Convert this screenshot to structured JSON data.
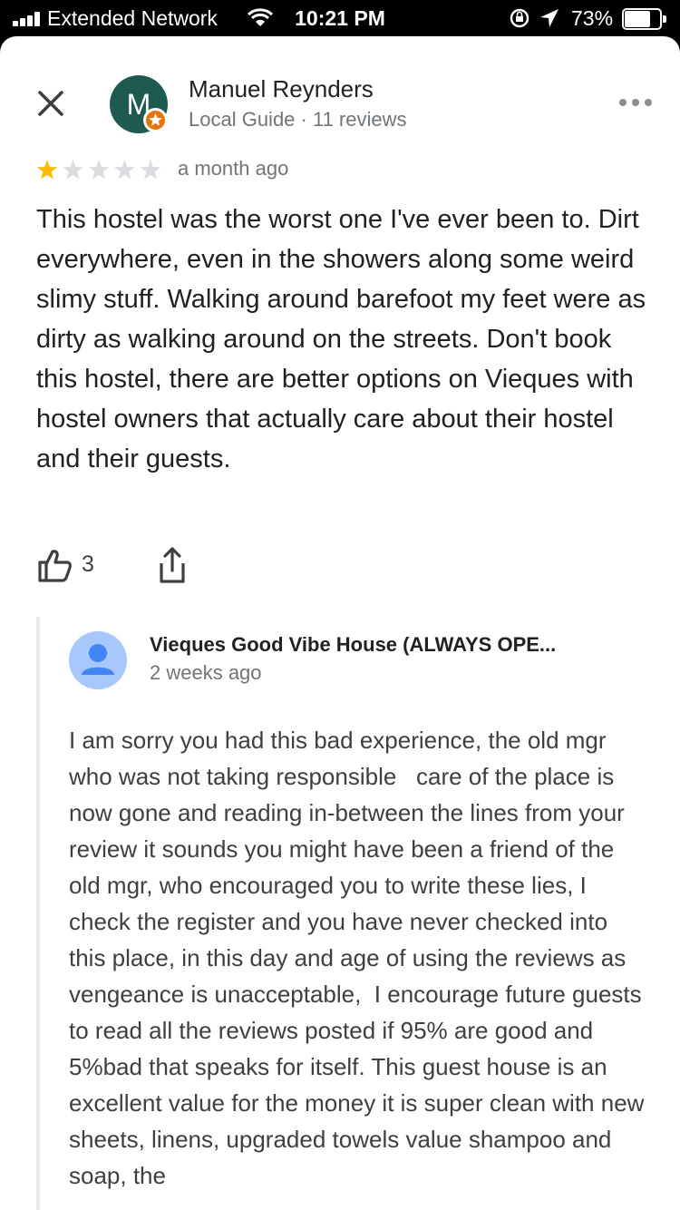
{
  "status_bar": {
    "carrier": "Extended Network",
    "time": "10:21 PM",
    "battery_percent": "73%",
    "battery_level": 0.73,
    "icons": [
      "signal-icon",
      "wifi-icon",
      "rotation-lock-icon",
      "location-icon",
      "battery-icon"
    ]
  },
  "review": {
    "avatar_initial": "M",
    "avatar_color": "#1e5a4f",
    "badge_color": "#e8710a",
    "reviewer_name": "Manuel Reynders",
    "reviewer_meta": "Local Guide · 11 reviews",
    "rating": 1,
    "rating_max": 5,
    "star_color": "#fbbc04",
    "date": "a month ago",
    "text": "This hostel was the worst one I've ever been to. Dirt everywhere, even in the showers along some weird slimy stuff. Walking around barefoot my feet were as dirty as walking around on the streets. Don't book this hostel, there are better options on Vieques with hostel owners that actually care about their hostel and their guests.",
    "like_count": "3",
    "icons": [
      "close-icon",
      "more-icon",
      "thumbs-up-icon",
      "share-icon"
    ]
  },
  "owner_reply": {
    "name": "Vieques Good Vibe House (ALWAYS OPE...",
    "date": "2 weeks ago",
    "text": "I am sorry you had this bad experience, the old mgr who was not taking responsible   care of the place is now gone and reading in-between the lines from your review it sounds you might have been a friend of the old mgr, who encouraged you to write these lies, I check the register and you have never checked into this place, in this day and age of using the reviews as vengeance is unacceptable,  I encourage future guests to read all the reviews posted if 95% are good and 5%bad that speaks for itself. This guest house is an excellent value for the money it is super clean with new sheets, linens, upgraded towels value shampoo and soap, the"
  }
}
